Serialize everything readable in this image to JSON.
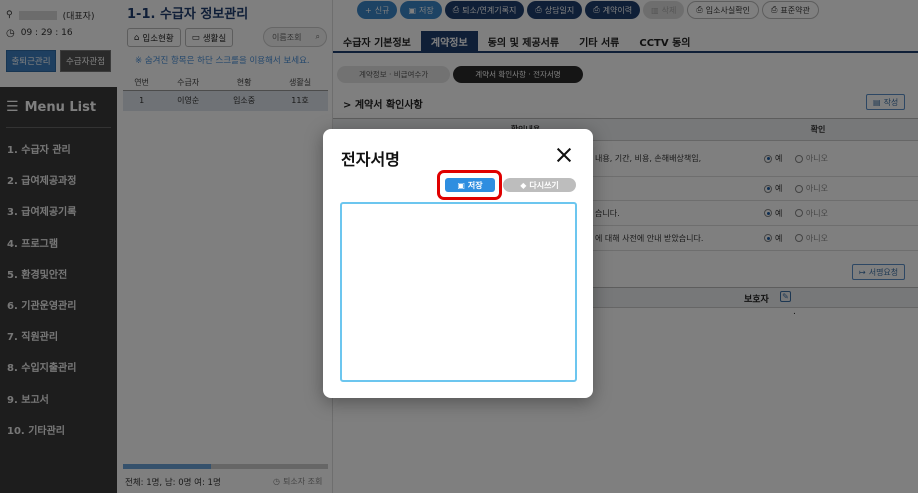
{
  "sidebar": {
    "user_role": "(대표자)",
    "clock": "09 : 29 : 16",
    "checkin_label": "출퇴근관리",
    "recipient_view_label": "수급자관점",
    "menu_title": "Menu List",
    "menu_items": [
      "1. 수급자 관리",
      "2. 급여제공과정",
      "3. 급여제공기록",
      "4. 프로그램",
      "5. 환경및안전",
      "6. 기관운영관리",
      "7. 직원관리",
      "8. 수입지출관리",
      "9. 보고서",
      "10. 기타관리"
    ]
  },
  "list_panel": {
    "title": "1-1. 수급자 정보관리",
    "btn_admission": "입소현황",
    "btn_room": "생활실",
    "search_placeholder": "이름조회",
    "hint": "※ 숨겨진 항목은 하단 스크롤을 이용해서 보세요.",
    "columns": [
      "연번",
      "수급자",
      "현황",
      "생활실"
    ],
    "rows": [
      {
        "no": "1",
        "name": "이영순",
        "status": "입소중",
        "room": "11호"
      }
    ],
    "footer": "전체: 1명, 남: 0명 여: 1명",
    "footer_right": "퇴소자 조회"
  },
  "main": {
    "actions": [
      {
        "label": "신규",
        "style": "blue",
        "icon": "+"
      },
      {
        "label": "저장",
        "style": "blue",
        "icon": "▣"
      },
      {
        "label": "퇴소/연계기록지",
        "style": "navy",
        "icon": "⎙"
      },
      {
        "label": "상담일지",
        "style": "navy",
        "icon": "⎙"
      },
      {
        "label": "계약이력",
        "style": "navy",
        "icon": "⎙"
      },
      {
        "label": "삭제",
        "style": "gray",
        "icon": "🗑"
      },
      {
        "label": "입소사실확인",
        "style": "white",
        "icon": "⎙"
      },
      {
        "label": "표준약관",
        "style": "white",
        "icon": "⎙"
      }
    ],
    "tabs": [
      "수급자 기본정보",
      "계약정보",
      "동의 및 제공서류",
      "기타 서류",
      "CCTV 동의"
    ],
    "active_tab": "계약정보",
    "subtabs": [
      "계약정보 · 비급여수가",
      "계약서 확인사항 · 전자서명"
    ],
    "section_title": "> 계약서 확인사항",
    "write_label": "작성",
    "table_header_content": "확인내용",
    "table_header_confirm": "확인",
    "rows": [
      {
        "text": "내용, 기간, 비용, 손해배상책임,",
        "yes": "예",
        "no": "아니오"
      },
      {
        "text": "",
        "yes": "예",
        "no": "아니오"
      },
      {
        "text": "습니다.",
        "yes": "예",
        "no": "아니오"
      },
      {
        "text": "에 대해 사전에 안내 받았습니다.",
        "yes": "예",
        "no": "아니오"
      }
    ],
    "sign_request_label": "서명요청",
    "guardian_label": "보호자",
    "guardian_dot": "."
  },
  "modal": {
    "title": "전자서명",
    "save_label": "저장",
    "rewrite_label": "다시쓰기",
    "close_icon": "close-icon"
  },
  "colors": {
    "navy": "#1f3f6e",
    "blue": "#3a86c8",
    "highlight": "#e00000",
    "canvas_border": "#6cc6ef"
  }
}
